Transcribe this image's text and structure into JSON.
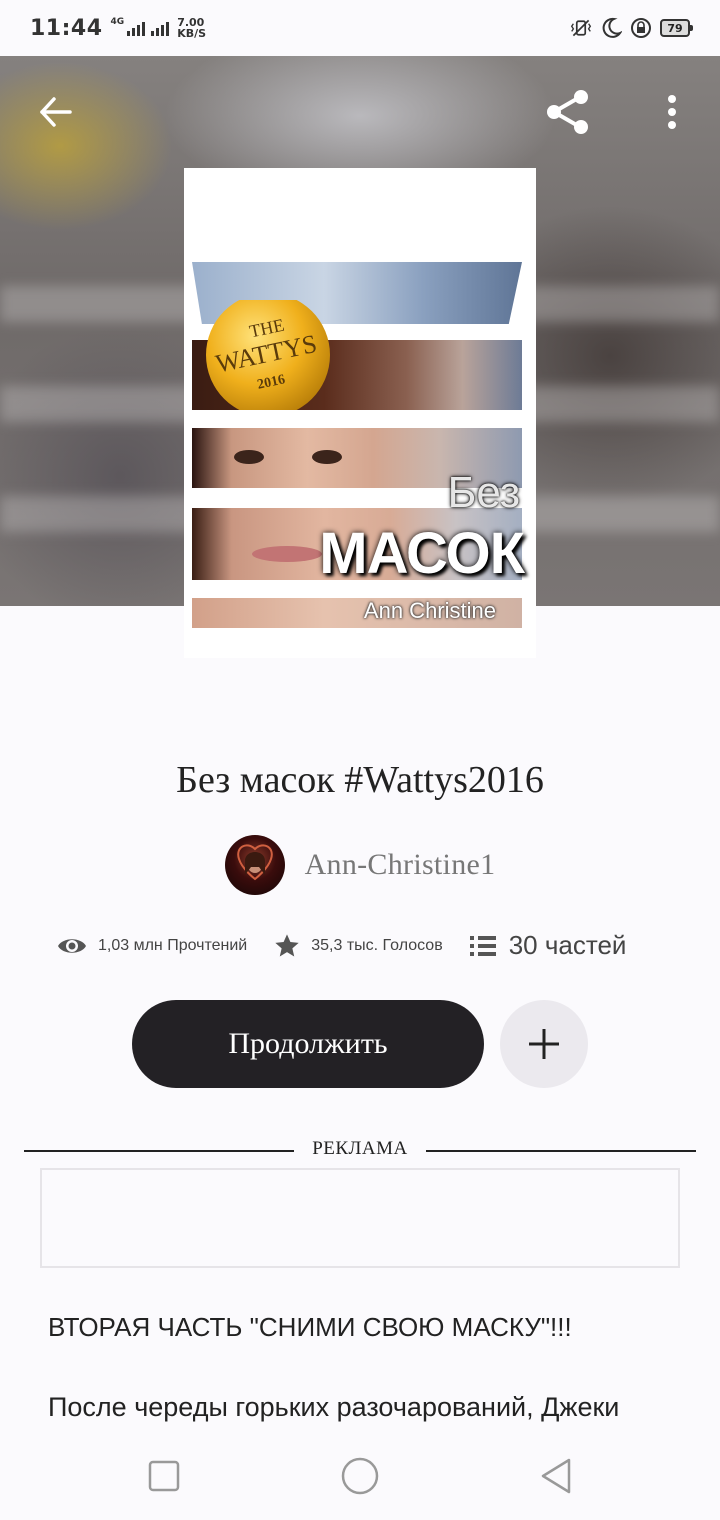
{
  "status_bar": {
    "time": "11:44",
    "network": "4G",
    "speed_value": "7.00",
    "speed_unit": "KB/S",
    "battery": "79"
  },
  "cover": {
    "badge_line1": "THE",
    "badge_line2": "WATTYS",
    "badge_line3": "2016",
    "title_small": "Без",
    "title_big": "МАСОК",
    "author": "Ann Christine"
  },
  "book": {
    "title": "Без масок #Wattys2016",
    "author": "Ann-Christine1"
  },
  "stats": {
    "reads": "1,03 млн Прочтений",
    "votes": "35,3 тыс. Голосов",
    "parts": "30 частей"
  },
  "actions": {
    "continue_label": "Продолжить"
  },
  "ad": {
    "label": "РЕКЛАМА"
  },
  "description": {
    "line1": "ВТОРАЯ ЧАСТЬ \"СНИМИ СВОЮ МАСКУ\"!!!",
    "line2": "После череды горьких разочарований, Джеки"
  },
  "colors": {
    "primary_button": "#232125",
    "secondary_button": "#ebe9ee",
    "background": "#fbfafd"
  }
}
